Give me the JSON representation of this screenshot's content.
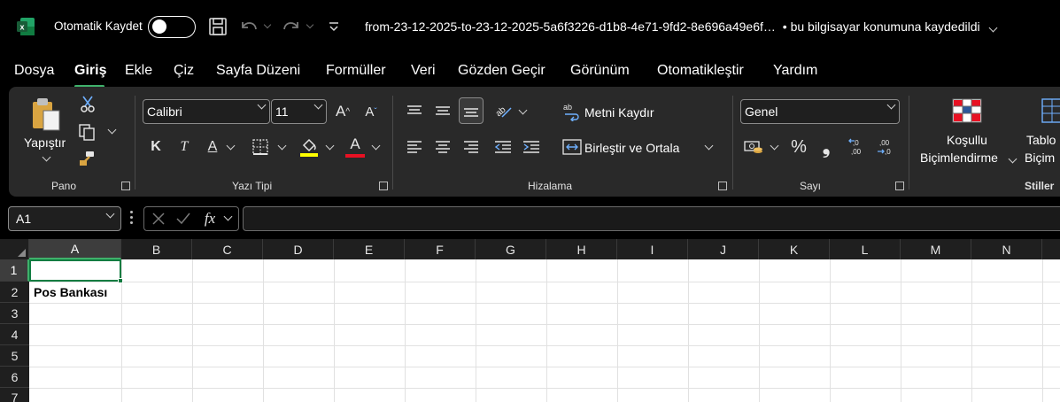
{
  "titlebar": {
    "autosave_label": "Otomatik Kaydet",
    "autosave_state": "off",
    "filename": "from-23-12-2025-to-23-12-2025-5a6f3226-d1b8-4e71-9fd2-8e696a49e6f…",
    "save_location": "• bu bilgisayar konumuna kaydedildi",
    "brand_color": "#107c41"
  },
  "menu": {
    "tabs": [
      "Dosya",
      "Giriş",
      "Ekle",
      "Çiz",
      "Sayfa Düzeni",
      "Formüller",
      "Veri",
      "Gözden Geçir",
      "Görünüm",
      "Otomatikleştir",
      "Yardım"
    ],
    "active": "Giriş"
  },
  "ribbon": {
    "pano": {
      "label": "Pano",
      "paste": "Yapıştır"
    },
    "font": {
      "label": "Yazı Tipi",
      "font_name": "Calibri",
      "font_size": "11",
      "bold": "K",
      "italic": "T",
      "underline": "A",
      "font_color_letter": "A"
    },
    "align": {
      "label": "Hizalama",
      "wrap": "Metni Kaydır",
      "merge": "Birleştir ve Ortala"
    },
    "number": {
      "label": "Sayı",
      "format": "Genel",
      "percent": "%",
      "comma": "❟",
      "inc_dec_1": ",0\n,00",
      "inc_dec_2": ",00\n,0"
    },
    "styles": {
      "label": "Stiller",
      "conditional_1": "Koşullu",
      "conditional_2": "Biçimlendirme",
      "table_1": "Tablo",
      "table_2": "Biçim"
    }
  },
  "formula": {
    "name_box": "A1",
    "fx": "fx",
    "value": ""
  },
  "sheet": {
    "columns": [
      "A",
      "B",
      "C",
      "D",
      "E",
      "F",
      "G",
      "H",
      "I",
      "J",
      "K",
      "L",
      "M",
      "N"
    ],
    "rows": [
      "1",
      "2",
      "3",
      "4",
      "5",
      "6",
      "7"
    ],
    "selected_cell": "A1",
    "cells": {
      "A2": "Pos Bankası"
    }
  }
}
